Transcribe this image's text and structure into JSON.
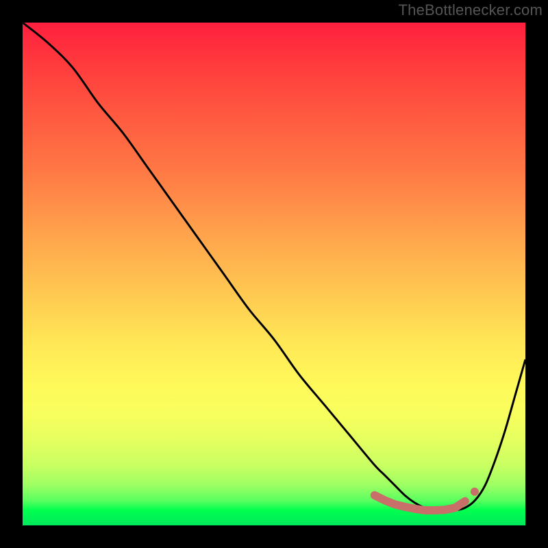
{
  "attribution": "TheBottlenecker.com",
  "chart_data": {
    "type": "line",
    "title": "",
    "xlabel": "",
    "ylabel": "",
    "xlim": [
      0,
      100
    ],
    "ylim": [
      0,
      100
    ],
    "series": [
      {
        "name": "bottleneck-curve",
        "x": [
          0,
          5,
          10,
          15,
          20,
          25,
          30,
          35,
          40,
          45,
          50,
          55,
          60,
          65,
          70,
          72,
          74,
          76,
          78,
          80,
          82,
          84,
          86,
          88,
          90,
          92,
          94,
          96,
          98,
          100
        ],
        "y": [
          100,
          96,
          91,
          84,
          78,
          71,
          64,
          57,
          50,
          43,
          37,
          30,
          24,
          18,
          12,
          10,
          8,
          6,
          4.5,
          3.5,
          3,
          3,
          3,
          3.5,
          5,
          8,
          13,
          19,
          26,
          33
        ]
      }
    ],
    "markers": {
      "name": "highlight-range",
      "color": "#c96f6a",
      "x": [
        70,
        72,
        74,
        76,
        78,
        80,
        82,
        84,
        86,
        88
      ],
      "y": [
        6,
        5,
        4.2,
        3.7,
        3.3,
        3.0,
        3.0,
        3.1,
        3.5,
        4.8
      ]
    },
    "gradient_stops": [
      {
        "pos": 0,
        "color": "#ff1f3f"
      },
      {
        "pos": 50,
        "color": "#ffd552"
      },
      {
        "pos": 78,
        "color": "#f7ff5e"
      },
      {
        "pos": 100,
        "color": "#00e85c"
      }
    ]
  }
}
